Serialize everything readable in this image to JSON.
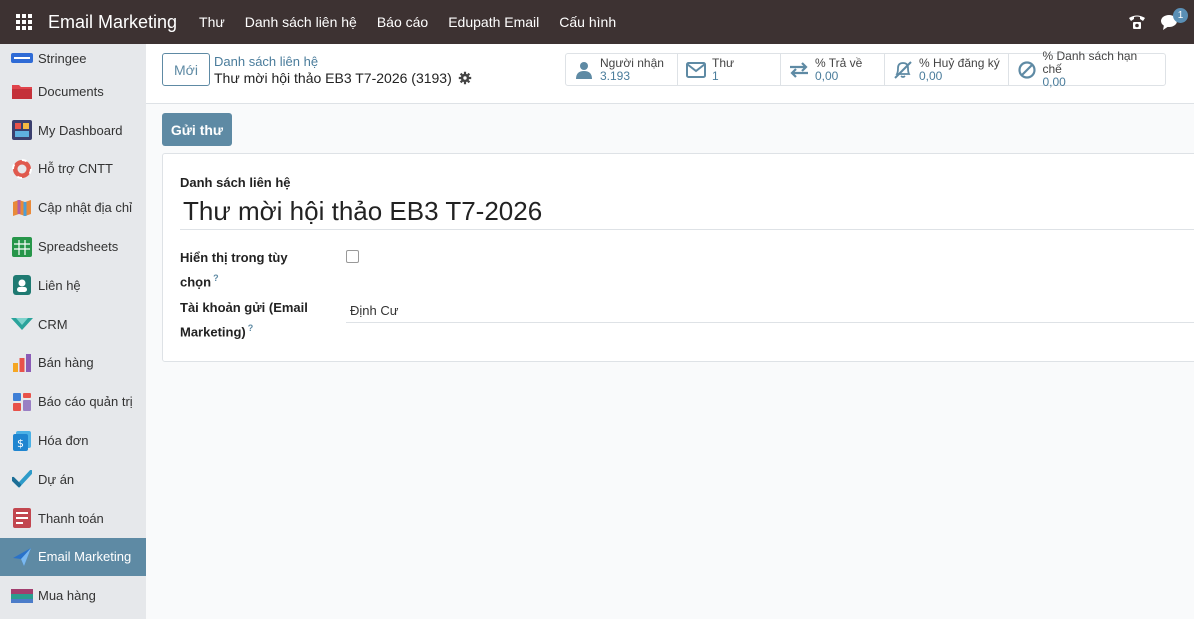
{
  "topbar": {
    "app_name": "Email Marketing",
    "menu": [
      "Thư",
      "Danh sách liên hệ",
      "Báo cáo",
      "Edupath Email",
      "Cấu hình"
    ],
    "chat_badge": "1"
  },
  "sidebar": {
    "items": [
      {
        "label": "Stringee",
        "icon": "stringee-icon"
      },
      {
        "label": "Documents",
        "icon": "folder-icon"
      },
      {
        "label": "My Dashboard",
        "icon": "dashboard-icon"
      },
      {
        "label": "Hỗ trợ CNTT",
        "icon": "lifebuoy-icon"
      },
      {
        "label": "Cập nhật địa chỉ",
        "icon": "map-icon"
      },
      {
        "label": "Spreadsheets",
        "icon": "spreadsheet-icon"
      },
      {
        "label": "Liên hệ",
        "icon": "contact-icon"
      },
      {
        "label": "CRM",
        "icon": "crm-icon"
      },
      {
        "label": "Bán hàng",
        "icon": "sales-icon"
      },
      {
        "label": "Báo cáo quản trị",
        "icon": "report-icon"
      },
      {
        "label": "Hóa đơn",
        "icon": "invoice-icon"
      },
      {
        "label": "Dự án",
        "icon": "project-icon"
      },
      {
        "label": "Thanh toán",
        "icon": "payment-icon"
      },
      {
        "label": "Email Marketing",
        "icon": "email-marketing-icon"
      },
      {
        "label": "Mua hàng",
        "icon": "purchase-icon"
      }
    ],
    "active": "Email Marketing"
  },
  "control": {
    "new_label": "Mới",
    "breadcrumb_parent": "Danh sách liên hệ",
    "breadcrumb_current": "Thư mời hội thảo EB3 T7-2026 (3193)"
  },
  "stats": [
    {
      "label": "Người nhận",
      "value": "3.193",
      "icon": "user-icon"
    },
    {
      "label": "Thư",
      "value": "1",
      "icon": "envelope-icon"
    },
    {
      "label": "% Trả về",
      "value": "0,00",
      "icon": "exchange-icon"
    },
    {
      "label": "% Huỷ đăng ký",
      "value": "0,00",
      "icon": "bell-slash-icon"
    },
    {
      "label": "% Danh sách hạn chế",
      "value": "0,00",
      "icon": "ban-icon"
    }
  ],
  "actions": {
    "send_label": "Gửi thư"
  },
  "form": {
    "name_label": "Danh sách liên hệ",
    "name_value": "Thư mời hội thảo EB3 T7-2026",
    "show_label_1": "Hiển thị trong tùy",
    "show_label_2": "chọn",
    "sender_label_1": "Tài khoản gửi (Email",
    "sender_label_2": "Marketing)",
    "sender_value": "Định Cư",
    "help_mark": "?"
  },
  "colors": {
    "topbar": "#3d3232",
    "accent": "#5e8aa4",
    "sidebar": "#e6e8eb"
  }
}
